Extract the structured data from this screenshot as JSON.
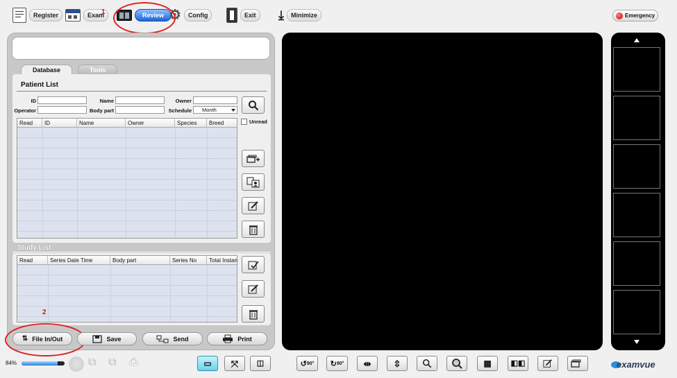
{
  "toolbar": {
    "register": "Register",
    "exam": "Exam",
    "review": "Review",
    "config": "Config",
    "exit": "Exit",
    "minimize": "Minimize",
    "emergency": "Emergency"
  },
  "annotations": {
    "marker1": "1",
    "marker2": "2"
  },
  "tabs": {
    "database": "Database",
    "tools": "Tools"
  },
  "patient_list": {
    "title": "Patient List",
    "labels": {
      "id": "ID",
      "name": "Name",
      "owner": "Owner",
      "operator": "Operator",
      "body_part": "Body part",
      "schedule": "Schedule"
    },
    "schedule_value": "Month",
    "unread_label": "Unread",
    "columns": [
      "Read",
      "ID",
      "Name",
      "Owner",
      "Species",
      "Breed"
    ]
  },
  "study_list": {
    "title": "Study List",
    "columns": [
      "Read",
      "Series Date Time",
      "Body part",
      "Series No",
      "Total Instan"
    ]
  },
  "bottom_buttons": {
    "file": "File In/Out",
    "save": "Save",
    "send": "Send",
    "print": "Print"
  },
  "status": {
    "progress_text": "84%",
    "progress_value": 84
  },
  "bottom_toolbar": {
    "rotate_left": "90°",
    "rotate_right": "90°"
  },
  "brand": {
    "logo_text": "examvue"
  },
  "colors": {
    "accent": "#1d65d6",
    "annotation": "#e02020"
  }
}
